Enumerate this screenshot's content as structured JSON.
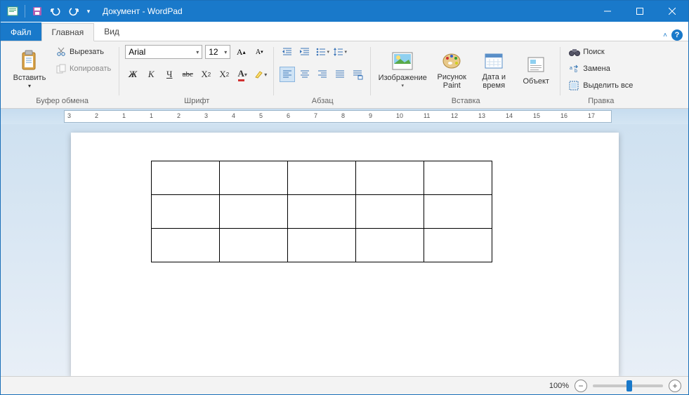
{
  "title": "Документ - WordPad",
  "tabs": {
    "file": "Файл",
    "home": "Главная",
    "view": "Вид"
  },
  "clipboard": {
    "paste": "Вставить",
    "cut": "Вырезать",
    "copy": "Копировать",
    "group": "Буфер обмена"
  },
  "font": {
    "name": "Arial",
    "size": "12",
    "group": "Шрифт"
  },
  "paragraph": {
    "group": "Абзац"
  },
  "insert": {
    "picture": "Изображение",
    "paint": "Рисунок Paint",
    "datetime": "Дата и время",
    "object": "Объект",
    "group": "Вставка"
  },
  "editing": {
    "find": "Поиск",
    "replace": "Замена",
    "selectall": "Выделить все",
    "group": "Правка"
  },
  "ruler_marks": [
    "3",
    "2",
    "1",
    "1",
    "2",
    "3",
    "4",
    "5",
    "6",
    "7",
    "8",
    "9",
    "10",
    "11",
    "12",
    "13",
    "14",
    "15",
    "16",
    "17"
  ],
  "status": {
    "zoom": "100%"
  },
  "doc": {
    "rows": 3,
    "cols": 5
  }
}
